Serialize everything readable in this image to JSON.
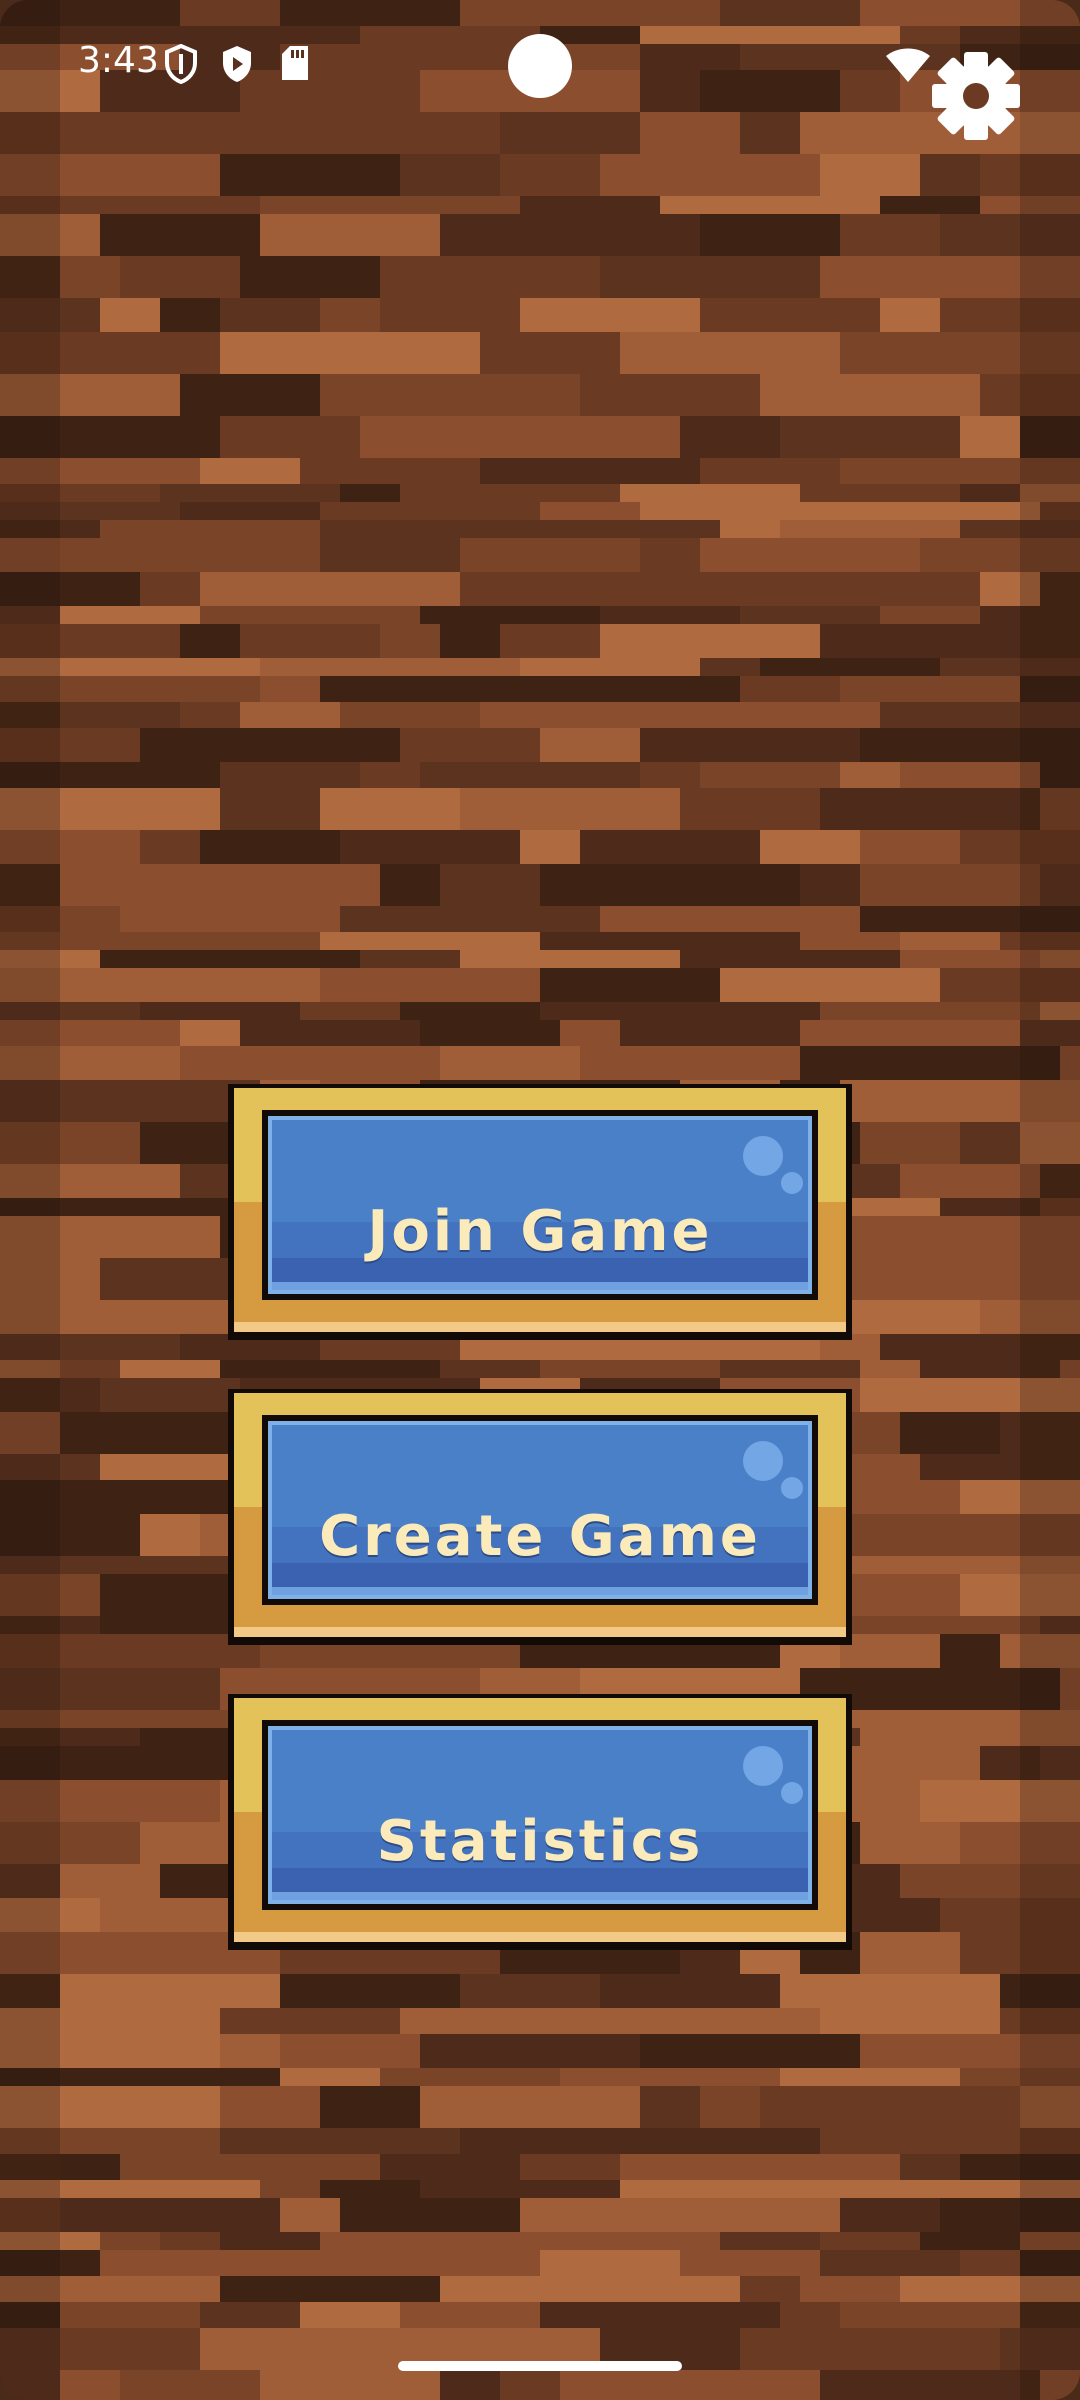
{
  "status_bar": {
    "time": "3:43",
    "icons": [
      "shield-outline-icon",
      "shield-play-icon",
      "sd-card-icon",
      "wifi-icon",
      "battery-icon"
    ]
  },
  "settings": {
    "icon": "gear-icon"
  },
  "menu": {
    "items": [
      {
        "label": "Join Game"
      },
      {
        "label": "Create Game"
      },
      {
        "label": "Statistics"
      }
    ]
  },
  "colors": {
    "wood_dark": "#3e2214",
    "wood_mid": "#6b3a22",
    "wood_light": "#a05e38",
    "button_blue": "#4a80c8",
    "button_blue_dark": "#3a62b0",
    "frame_gold": "#e4c25a",
    "frame_gold_dark": "#d69a40",
    "label_cream": "#fbeaba"
  }
}
